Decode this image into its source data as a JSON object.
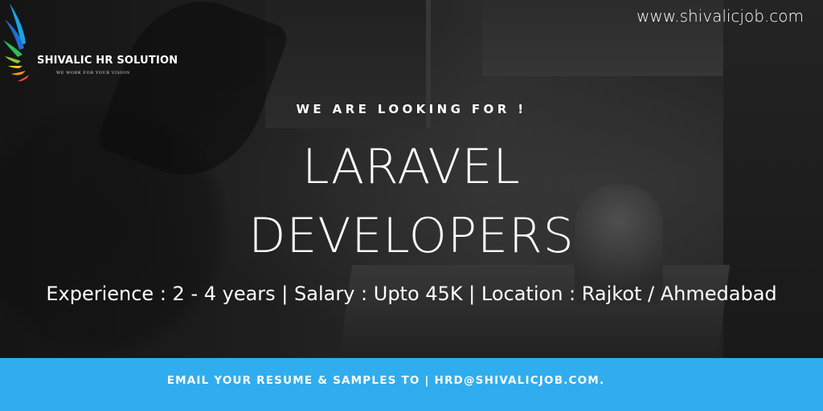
{
  "brand": {
    "name": "SHIVALIC HR SOLUTION",
    "tagline": "WE WORK FOR YOUR VISION",
    "website": "www.shivalicjob.com",
    "logo_colors": [
      "#1aa3e8",
      "#1f6fd1",
      "#2bbf5a",
      "#8cc63f",
      "#f4c430",
      "#f39c12",
      "#e74c3c"
    ]
  },
  "headline": {
    "eyebrow": "WE ARE LOOKING FOR !",
    "line1": "LARAVEL",
    "line2": "DEVELOPERS"
  },
  "details": "Experience : 2 - 4  years | Salary : Upto 45K | Location : Rajkot / Ahmedabad",
  "footer": {
    "text": "EMAIL YOUR RESUME & SAMPLES TO | HRD@SHIVALICJOB.COM.",
    "background": "#30adee"
  }
}
